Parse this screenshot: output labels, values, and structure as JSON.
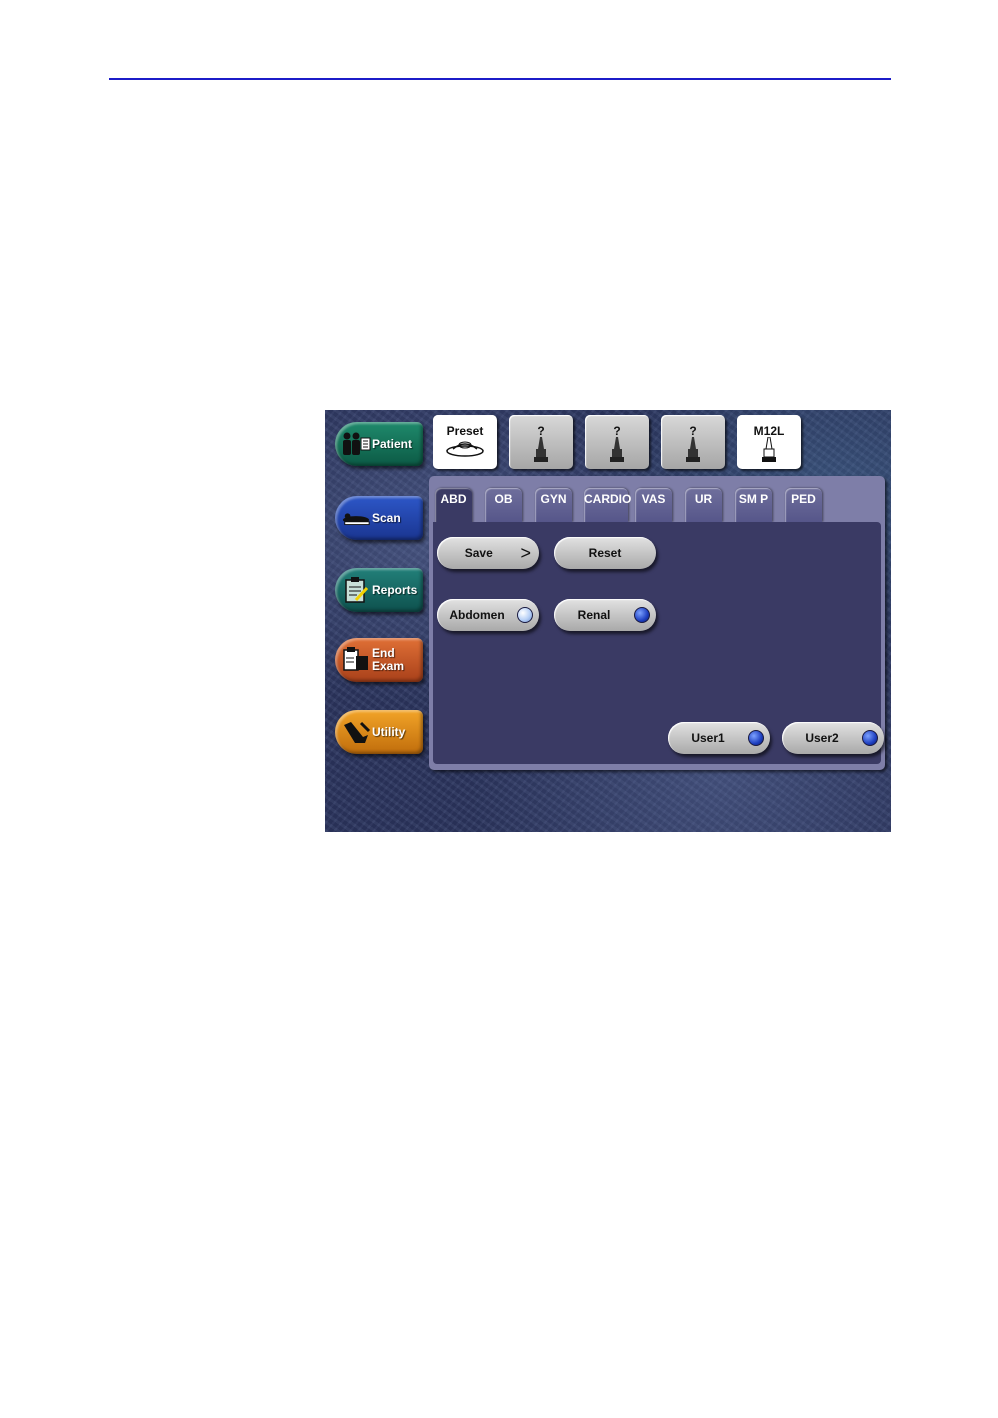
{
  "nav": [
    {
      "id": "patient",
      "label": "Patient",
      "icon": "patient-icon"
    },
    {
      "id": "scan",
      "label": "Scan",
      "icon": "scan-icon"
    },
    {
      "id": "reports",
      "label": "Reports",
      "icon": "reports-icon"
    },
    {
      "id": "end-exam",
      "label": "End Exam",
      "icon": "end-exam-icon"
    },
    {
      "id": "utility",
      "label": "Utility",
      "icon": "utility-icon"
    }
  ],
  "probes": [
    {
      "label": "Preset",
      "selected": true
    },
    {
      "label": "?",
      "selected": false
    },
    {
      "label": "?",
      "selected": false
    },
    {
      "label": "?",
      "selected": false
    },
    {
      "label": "M12L",
      "selected": true
    }
  ],
  "tabs": [
    "ABD",
    "OB",
    "GYN",
    "CARDIO",
    "VAS",
    "UR",
    "SM P",
    "PED"
  ],
  "active_tab": "ABD",
  "buttons": {
    "save": "Save",
    "reset": "Reset",
    "abdomen": "Abdomen",
    "renal": "Renal",
    "user1": "User1",
    "user2": "User2"
  },
  "colors": {
    "rule": "#1c1cc8",
    "led": "#1e3fc0"
  }
}
